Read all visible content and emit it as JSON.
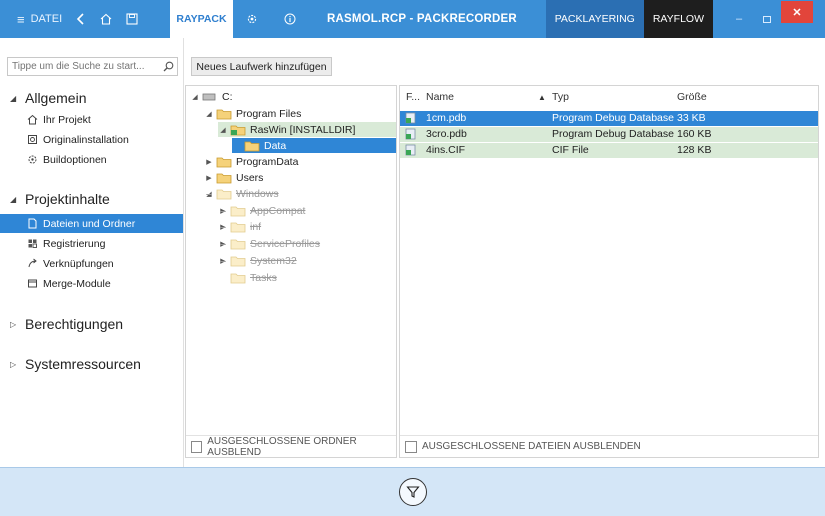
{
  "titlebar": {
    "menu_label": "DATEI",
    "tab_raypack": "RAYPACK",
    "title": "RASMOL.RCP - PACKRECORDER",
    "switch_packlayering": "PACKLAYERING",
    "switch_rayflow": "RAYFLOW",
    "accent": "#3b8fd6",
    "close_color": "#e2453b"
  },
  "sidebar": {
    "search_placeholder": "Tippe um die Suche zu start...",
    "sections": [
      {
        "label": "Allgemein",
        "items": [
          "Ihr Projekt",
          "Originalinstallation",
          "Buildoptionen"
        ]
      },
      {
        "label": "Projektinhalte",
        "items": [
          "Dateien und Ordner",
          "Registrierung",
          "Verknüpfungen",
          "Merge-Module"
        ]
      },
      {
        "label": "Berechtigungen",
        "items": []
      },
      {
        "label": "Systemressourcen",
        "items": []
      }
    ],
    "active_item": "Dateien und Ordner"
  },
  "toolbar": {
    "add_drive_label": "Neues Laufwerk hinzufügen"
  },
  "tree": {
    "nodes": [
      {
        "label": "C:"
      },
      {
        "label": "Program Files"
      },
      {
        "label": "RasWin [INSTALLDIR]"
      },
      {
        "label": "Data"
      },
      {
        "label": "ProgramData"
      },
      {
        "label": "Users"
      },
      {
        "label": "Windows"
      },
      {
        "label": "AppCompat"
      },
      {
        "label": "inf"
      },
      {
        "label": "ServiceProfiles"
      },
      {
        "label": "System32"
      },
      {
        "label": "Tasks"
      }
    ],
    "footer_checkbox": "AUSGESCHLOSSENE ORDNER AUSBLEND"
  },
  "files": {
    "columns": {
      "flag": "F...",
      "name": "Name",
      "type": "Typ",
      "size": "Größe"
    },
    "rows": [
      {
        "name": "1cm.pdb",
        "type": "Program Debug Database",
        "size": "33 KB"
      },
      {
        "name": "3cro.pdb",
        "type": "Program Debug Database",
        "size": "160 KB"
      },
      {
        "name": "4ins.CIF",
        "type": "CIF File",
        "size": "128 KB"
      }
    ],
    "footer_checkbox": "AUSGESCHLOSSENE DATEIEN AUSBLENDEN"
  },
  "bottombar": {
    "filter_icon": "filter-icon"
  }
}
